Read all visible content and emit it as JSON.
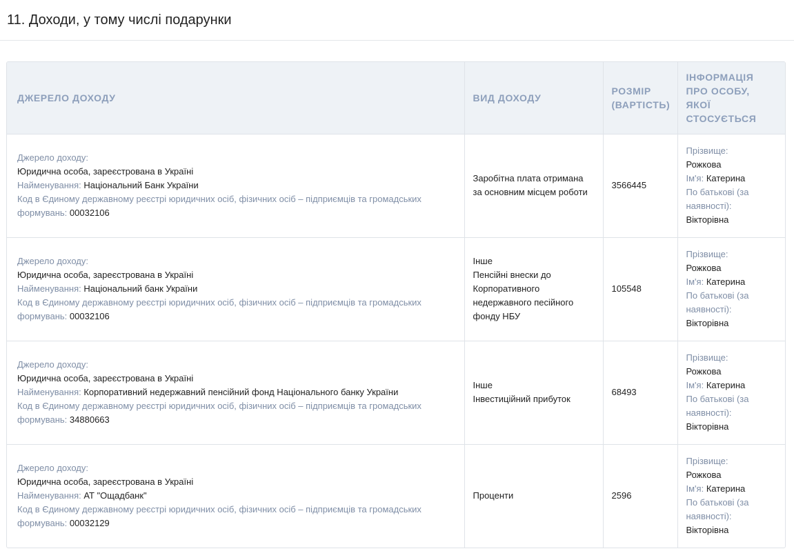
{
  "section": {
    "title": "11. Доходи, у тому числі подарунки"
  },
  "table": {
    "headers": {
      "source": "Джерело доходу",
      "type": "Вид доходу",
      "amount": "Розмір (вартість)",
      "person": "Інформація про особу, якої стосується"
    },
    "labels": {
      "source": "Джерело доходу:",
      "name": "Найменування:",
      "code": "Код в Єдиному державному реєстрі юридичних осіб, фізичних осіб – підприємців та громадських формувань:",
      "surname": "Прізвище:",
      "firstname": "Ім'я:",
      "patronymic": "По батькові (за наявності):"
    },
    "rows": [
      {
        "entity_type": "Юридична особа, зареєстрована в Україні",
        "name": "Національний Банк України",
        "code": "00032106",
        "income_type_lines": [
          "Заробітна плата отримана за основним місцем роботи"
        ],
        "amount": "3566445",
        "surname": "Рожкова",
        "firstname": "Катерина",
        "patronymic": "Вікторівна"
      },
      {
        "entity_type": "Юридична особа, зареєстрована в Україні",
        "name": "Національний банк України",
        "code": "00032106",
        "income_type_lines": [
          "Інше",
          "Пенсійні внески до Корпоративного недержавного песійного фонду НБУ"
        ],
        "amount": "105548",
        "surname": "Рожкова",
        "firstname": "Катерина",
        "patronymic": "Вікторівна"
      },
      {
        "entity_type": "Юридична особа, зареєстрована в Україні",
        "name": "Корпоративний недержавний пенсійний фонд Національного банку України",
        "code": "34880663",
        "income_type_lines": [
          "Інше",
          "Інвестиційний прибуток"
        ],
        "amount": "68493",
        "surname": "Рожкова",
        "firstname": "Катерина",
        "patronymic": "Вікторівна"
      },
      {
        "entity_type": "Юридична особа, зареєстрована в Україні",
        "name": "АТ \"Ощадбанк\"",
        "code": "00032129",
        "income_type_lines": [
          "Проценти"
        ],
        "amount": "2596",
        "surname": "Рожкова",
        "firstname": "Катерина",
        "patronymic": "Вікторівна"
      }
    ]
  }
}
